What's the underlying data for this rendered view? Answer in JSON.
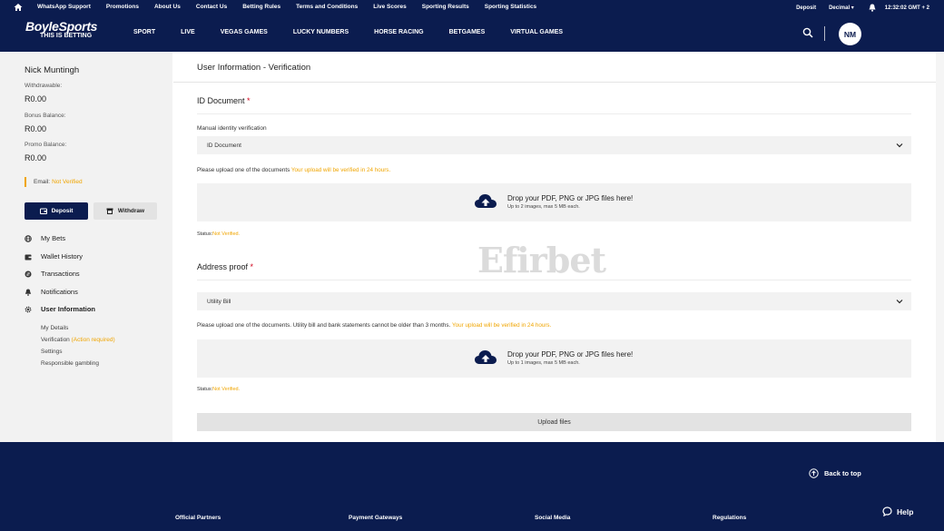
{
  "topbar": {
    "links": [
      "WhatsApp Support",
      "Promotions",
      "About Us",
      "Contact Us",
      "Betting Rules",
      "Terms and Conditions",
      "Live Scores",
      "Sporting Results",
      "Sporting Statistics"
    ],
    "deposit": "Deposit",
    "odds_format": "Decimal",
    "time": "12:32:02 GMT + 2"
  },
  "nav": {
    "logo_main": "BoyleSports",
    "logo_tagline": "THIS IS BETTING",
    "items": [
      "SPORT",
      "LIVE",
      "VEGAS GAMES",
      "LUCKY NUMBERS",
      "HORSE RACING",
      "BETGAMES",
      "VIRTUAL GAMES"
    ],
    "avatar_initials": "NM"
  },
  "sidebar": {
    "user_name": "Nick Muntingh",
    "withdrawable_label": "Withdrawable:",
    "withdrawable_value": "R0.00",
    "bonus_label": "Bonus Balance:",
    "bonus_value": "R0.00",
    "promo_label": "Promo Balance:",
    "promo_value": "R0.00",
    "email_label": "Email:",
    "email_status": "Not Verified",
    "deposit_btn": "Deposit",
    "withdraw_btn": "Withdraw",
    "menu": [
      "My Bets",
      "Wallet History",
      "Transactions",
      "Notifications",
      "User Information"
    ],
    "submenu": {
      "my_details": "My Details",
      "verification": "Verification",
      "action_required": "(Action required)",
      "settings": "Settings",
      "responsible": "Responsible gambling"
    }
  },
  "content": {
    "title": "User Information - Verification",
    "id_section": {
      "title": "ID Document",
      "required": "*",
      "field_label": "Manual identity verification",
      "selected": "ID Document",
      "note": "Please upload one of the documents",
      "note_highlight": "Your upload will be verified in 24 hours.",
      "drop_title": "Drop your PDF, PNG or JPG files here!",
      "drop_sub": "Up to 2 images, max 5 MB each.",
      "status_label": "Status:",
      "status_value": "Not Verified."
    },
    "address_section": {
      "title": "Address proof",
      "required": "*",
      "selected": "Utility Bill",
      "note": "Please upload one of the documents. Utility bill and bank statements cannot be older than 3 months.",
      "note_highlight": "Your upload will be verified in 24 hours.",
      "drop_title": "Drop your PDF, PNG or JPG files here!",
      "drop_sub": "Up to 1 images, max 5 MB each.",
      "status_label": "Status:",
      "status_value": "Not Verified."
    },
    "upload_btn": "Upload files",
    "watermark": "Efirbet"
  },
  "footer": {
    "back_to_top": "Back to top",
    "help": "Help",
    "columns": [
      "Official Partners",
      "Payment Gateways",
      "Social Media",
      "Regulations"
    ]
  },
  "colors": {
    "navy": "#0b1c4f",
    "accent_orange": "#f0a500",
    "required_red": "#d0021b"
  }
}
